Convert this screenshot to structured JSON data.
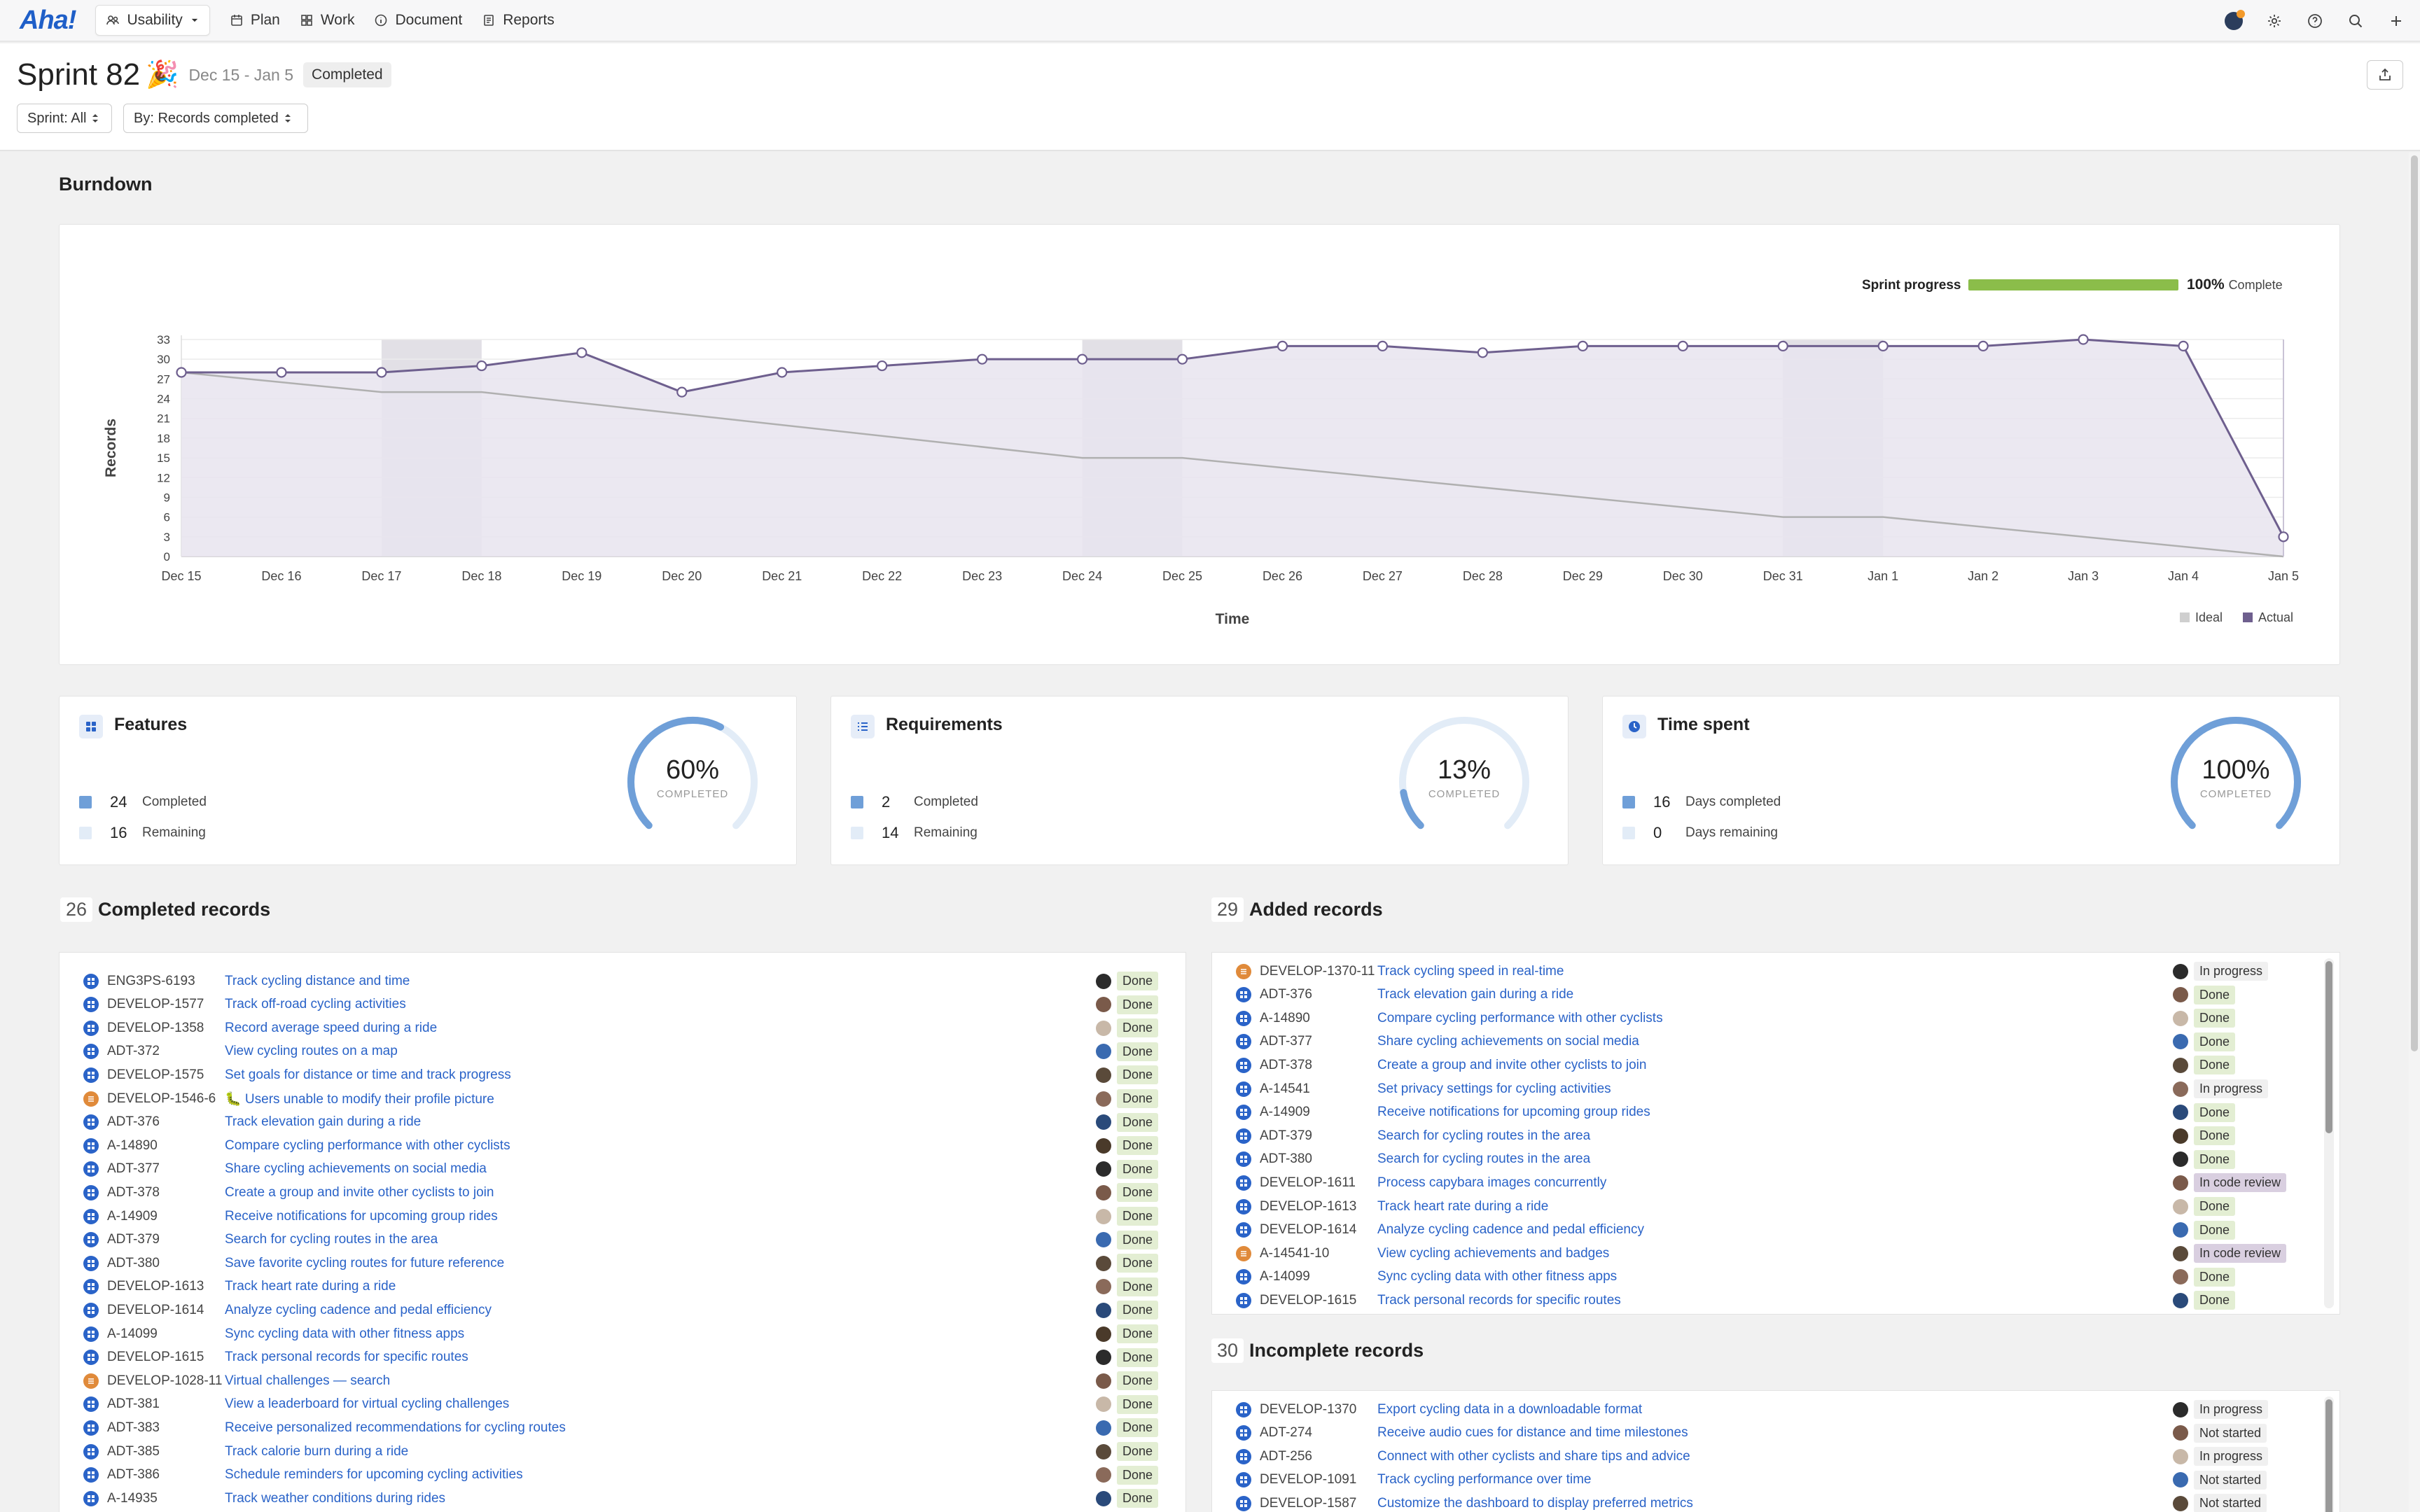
{
  "nav": {
    "logo": "Aha!",
    "workspace": "Usability",
    "items": [
      "Plan",
      "Work",
      "Document",
      "Reports"
    ]
  },
  "header": {
    "title": "Sprint 82",
    "emoji": "🎉",
    "dates": "Dec 15 - Jan 5",
    "status": "Completed",
    "filter_sprint": "Sprint: All",
    "filter_by": "By: Records completed"
  },
  "burndown": {
    "heading": "Burndown",
    "sprint_progress_label": "Sprint progress",
    "sprint_progress_pct": "100%",
    "sprint_progress_complete": "Complete",
    "progress_fraction": 1.0
  },
  "chart_data": {
    "type": "area",
    "xlabel": "Time",
    "ylabel": "Records",
    "categories": [
      "Dec 15",
      "Dec 16",
      "Dec 17",
      "Dec 18",
      "Dec 19",
      "Dec 20",
      "Dec 21",
      "Dec 22",
      "Dec 23",
      "Dec 24",
      "Dec 25",
      "Dec 26",
      "Dec 27",
      "Dec 28",
      "Dec 29",
      "Dec 30",
      "Dec 31",
      "Jan 1",
      "Jan 2",
      "Jan 3",
      "Jan 4",
      "Jan 5"
    ],
    "yticks": [
      0,
      3,
      6,
      9,
      12,
      15,
      18,
      21,
      24,
      27,
      30,
      33
    ],
    "ylim": [
      0,
      33
    ],
    "weekend_bands": [
      [
        2,
        3
      ],
      [
        9,
        10
      ],
      [
        16,
        17
      ]
    ],
    "series": [
      {
        "name": "Ideal",
        "color": "#aaaaaa",
        "values": [
          28,
          26.7,
          25.3,
          25.3,
          24,
          22.7,
          21.3,
          20,
          18.7,
          17.3,
          16,
          14.7,
          13.3,
          12,
          10.7,
          9.3,
          8,
          8,
          6.7,
          5.3,
          4,
          2.7
        ]
      },
      {
        "name": "Actual",
        "color": "#6e5f8e",
        "values": [
          28,
          28,
          28,
          29,
          31,
          25,
          28,
          29,
          30,
          30,
          30,
          32,
          32,
          31,
          32,
          32,
          32,
          32,
          32,
          33,
          32,
          3
        ]
      }
    ],
    "ideal_points": [
      [
        0,
        28
      ],
      [
        2,
        25
      ],
      [
        3,
        25
      ],
      [
        9,
        15
      ],
      [
        10,
        15
      ],
      [
        16,
        6
      ],
      [
        17,
        6
      ],
      [
        21,
        0
      ]
    ],
    "legend": [
      "Ideal",
      "Actual"
    ],
    "legend_position": "bottom-right",
    "grid": true
  },
  "stats": [
    {
      "title": "Features",
      "icon": "features-grid-icon",
      "completed": "24",
      "completed_label": "Completed",
      "remaining": "16",
      "remaining_label": "Remaining",
      "pct": "60%",
      "fraction": 0.6,
      "caption": "COMPLETED"
    },
    {
      "title": "Requirements",
      "icon": "requirements-list-icon",
      "completed": "2",
      "completed_label": "Completed",
      "remaining": "14",
      "remaining_label": "Remaining",
      "pct": "13%",
      "fraction": 0.13,
      "caption": "COMPLETED"
    },
    {
      "title": "Time spent",
      "icon": "clock-icon",
      "completed": "16",
      "completed_label": "Days completed",
      "remaining": "0",
      "remaining_label": "Days remaining",
      "pct": "100%",
      "fraction": 1.0,
      "caption": "COMPLETED"
    }
  ],
  "completed_records": {
    "count": "26",
    "heading": "Completed records",
    "rows": [
      {
        "id": "ENG3PS-6193",
        "name": "Track cycling distance and time",
        "status": "Done",
        "type": "feature"
      },
      {
        "id": "DEVELOP-1577",
        "name": "Track off-road cycling activities",
        "status": "Done",
        "type": "feature"
      },
      {
        "id": "DEVELOP-1358",
        "name": "Record average speed during a ride",
        "status": "Done",
        "type": "feature"
      },
      {
        "id": "ADT-372",
        "name": "View cycling routes on a map",
        "status": "Done",
        "type": "feature"
      },
      {
        "id": "DEVELOP-1575",
        "name": "Set goals for distance or time and track progress",
        "status": "Done",
        "type": "feature"
      },
      {
        "id": "DEVELOP-1546-6",
        "name": "🐛 Users unable to modify their profile picture",
        "status": "Done",
        "type": "requirement"
      },
      {
        "id": "ADT-376",
        "name": "Track elevation gain during a ride",
        "status": "Done",
        "type": "feature"
      },
      {
        "id": "A-14890",
        "name": "Compare cycling performance with other cyclists",
        "status": "Done",
        "type": "feature"
      },
      {
        "id": "ADT-377",
        "name": "Share cycling achievements on social media",
        "status": "Done",
        "type": "feature"
      },
      {
        "id": "ADT-378",
        "name": "Create a group and invite other cyclists to join",
        "status": "Done",
        "type": "feature"
      },
      {
        "id": "A-14909",
        "name": "Receive notifications for upcoming group rides",
        "status": "Done",
        "type": "feature"
      },
      {
        "id": "ADT-379",
        "name": "Search for cycling routes in the area",
        "status": "Done",
        "type": "feature"
      },
      {
        "id": "ADT-380",
        "name": "Save favorite cycling routes for future reference",
        "status": "Done",
        "type": "feature"
      },
      {
        "id": "DEVELOP-1613",
        "name": "Track heart rate during a ride",
        "status": "Done",
        "type": "feature"
      },
      {
        "id": "DEVELOP-1614",
        "name": "Analyze cycling cadence and pedal efficiency",
        "status": "Done",
        "type": "feature"
      },
      {
        "id": "A-14099",
        "name": "Sync cycling data with other fitness apps",
        "status": "Done",
        "type": "feature"
      },
      {
        "id": "DEVELOP-1615",
        "name": "Track personal records for specific routes",
        "status": "Done",
        "type": "feature"
      },
      {
        "id": "DEVELOP-1028-11",
        "name": "Virtual challenges — search",
        "status": "Done",
        "type": "requirement"
      },
      {
        "id": "ADT-381",
        "name": "View a leaderboard for virtual cycling challenges",
        "status": "Done",
        "type": "feature"
      },
      {
        "id": "ADT-383",
        "name": "Receive personalized recommendations for cycling routes",
        "status": "Done",
        "type": "feature"
      },
      {
        "id": "ADT-385",
        "name": "Track calorie burn during a ride",
        "status": "Done",
        "type": "feature"
      },
      {
        "id": "ADT-386",
        "name": "Schedule reminders for upcoming cycling activities",
        "status": "Done",
        "type": "feature"
      },
      {
        "id": "A-14935",
        "name": "Track weather conditions during rides",
        "status": "Done",
        "type": "feature"
      }
    ]
  },
  "added_records": {
    "count": "29",
    "heading": "Added records",
    "rows": [
      {
        "id": "DEVELOP-1370-11",
        "name": "Track cycling speed in real-time",
        "status": "In progress",
        "type": "requirement"
      },
      {
        "id": "ADT-376",
        "name": "Track elevation gain during a ride",
        "status": "Done",
        "type": "feature"
      },
      {
        "id": "A-14890",
        "name": "Compare cycling performance with other cyclists",
        "status": "Done",
        "type": "feature"
      },
      {
        "id": "ADT-377",
        "name": "Share cycling achievements on social media",
        "status": "Done",
        "type": "feature"
      },
      {
        "id": "ADT-378",
        "name": "Create a group and invite other cyclists to join",
        "status": "Done",
        "type": "feature"
      },
      {
        "id": "A-14541",
        "name": "Set privacy settings for cycling activities",
        "status": "In progress",
        "type": "feature"
      },
      {
        "id": "A-14909",
        "name": "Receive notifications for upcoming group rides",
        "status": "Done",
        "type": "feature"
      },
      {
        "id": "ADT-379",
        "name": "Search for cycling routes in the area",
        "status": "Done",
        "type": "feature"
      },
      {
        "id": "ADT-380",
        "name": "Search for cycling routes in the area",
        "status": "Done",
        "type": "feature"
      },
      {
        "id": "DEVELOP-1611",
        "name": "Process capybara images concurrently",
        "status": "In code review",
        "type": "feature"
      },
      {
        "id": "DEVELOP-1613",
        "name": "Track heart rate during a ride",
        "status": "Done",
        "type": "feature"
      },
      {
        "id": "DEVELOP-1614",
        "name": "Analyze cycling cadence and pedal efficiency",
        "status": "Done",
        "type": "feature"
      },
      {
        "id": "A-14541-10",
        "name": "View cycling achievements and badges",
        "status": "In code review",
        "type": "requirement"
      },
      {
        "id": "A-14099",
        "name": "Sync cycling data with other fitness apps",
        "status": "Done",
        "type": "feature"
      },
      {
        "id": "DEVELOP-1615",
        "name": "Track personal records for specific routes",
        "status": "Done",
        "type": "feature"
      }
    ]
  },
  "incomplete_records": {
    "count": "30",
    "heading": "Incomplete records",
    "rows": [
      {
        "id": "DEVELOP-1370",
        "name": "Export cycling data in a downloadable format",
        "status": "In progress",
        "type": "feature"
      },
      {
        "id": "ADT-274",
        "name": "Receive audio cues for distance and time milestones",
        "status": "Not started",
        "type": "feature"
      },
      {
        "id": "ADT-256",
        "name": "Connect with other cyclists and share tips and advice",
        "status": "In progress",
        "type": "feature"
      },
      {
        "id": "DEVELOP-1091",
        "name": "Track cycling performance over time",
        "status": "Not started",
        "type": "feature"
      },
      {
        "id": "DEVELOP-1587",
        "name": "Customize the dashboard to display preferred metrics",
        "status": "Not started",
        "type": "feature"
      }
    ]
  },
  "colors": {
    "accent": "#2a63c8",
    "progress_green": "#8bbd4a",
    "actual_line": "#6e5f8e",
    "actual_fill": "#e8e4ee",
    "donut": "#6f9fd8",
    "donut_track": "#e2ecf7"
  }
}
